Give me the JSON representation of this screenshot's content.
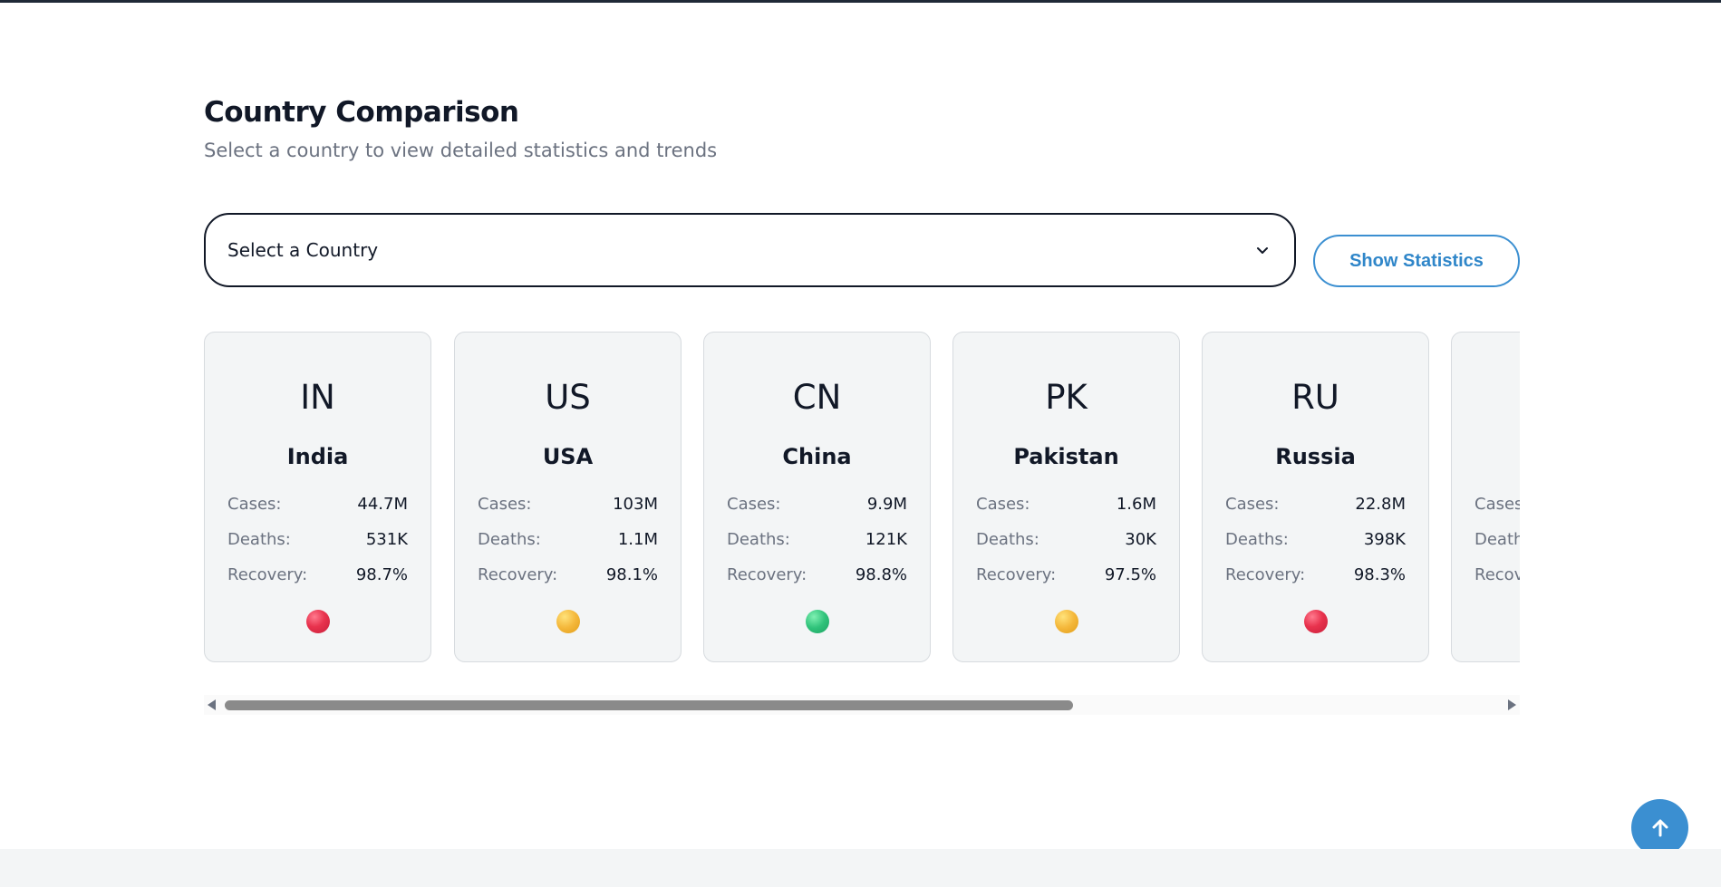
{
  "header": {
    "title": "Country Comparison",
    "subtitle": "Select a country to view detailed statistics and trends"
  },
  "controls": {
    "select_label": "Select a Country",
    "show_button": "Show Statistics"
  },
  "cards": [
    {
      "code": "IN",
      "name": "India",
      "cases_label": "Cases:",
      "cases": "44.7M",
      "deaths_label": "Deaths:",
      "deaths": "531K",
      "recovery_label": "Recovery:",
      "recovery": "98.7%",
      "status_color": "red"
    },
    {
      "code": "US",
      "name": "USA",
      "cases_label": "Cases:",
      "cases": "103M",
      "deaths_label": "Deaths:",
      "deaths": "1.1M",
      "recovery_label": "Recovery:",
      "recovery": "98.1%",
      "status_color": "yellow"
    },
    {
      "code": "CN",
      "name": "China",
      "cases_label": "Cases:",
      "cases": "9.9M",
      "deaths_label": "Deaths:",
      "deaths": "121K",
      "recovery_label": "Recovery:",
      "recovery": "98.8%",
      "status_color": "green"
    },
    {
      "code": "PK",
      "name": "Pakistan",
      "cases_label": "Cases:",
      "cases": "1.6M",
      "deaths_label": "Deaths:",
      "deaths": "30K",
      "recovery_label": "Recovery:",
      "recovery": "97.5%",
      "status_color": "yellow"
    },
    {
      "code": "RU",
      "name": "Russia",
      "cases_label": "Cases:",
      "cases": "22.8M",
      "deaths_label": "Deaths:",
      "deaths": "398K",
      "recovery_label": "Recovery:",
      "recovery": "98.3%",
      "status_color": "red"
    },
    {
      "code": "",
      "name": "",
      "cases_label": "Cases:",
      "cases": "",
      "deaths_label": "Deaths:",
      "deaths": "",
      "recovery_label": "Recovery:",
      "recovery": "",
      "status_color": ""
    }
  ],
  "colors": {
    "accent": "#3b8fd1",
    "status_red": "#e8324d",
    "status_yellow": "#f4b73a",
    "status_green": "#2fc27a",
    "card_bg": "#f3f5f6"
  },
  "icons": {
    "select_chevron": "chevron-down-icon",
    "scroll_left": "scroll-left-arrow-icon",
    "scroll_right": "scroll-right-arrow-icon",
    "back_to_top": "arrow-up-icon"
  }
}
